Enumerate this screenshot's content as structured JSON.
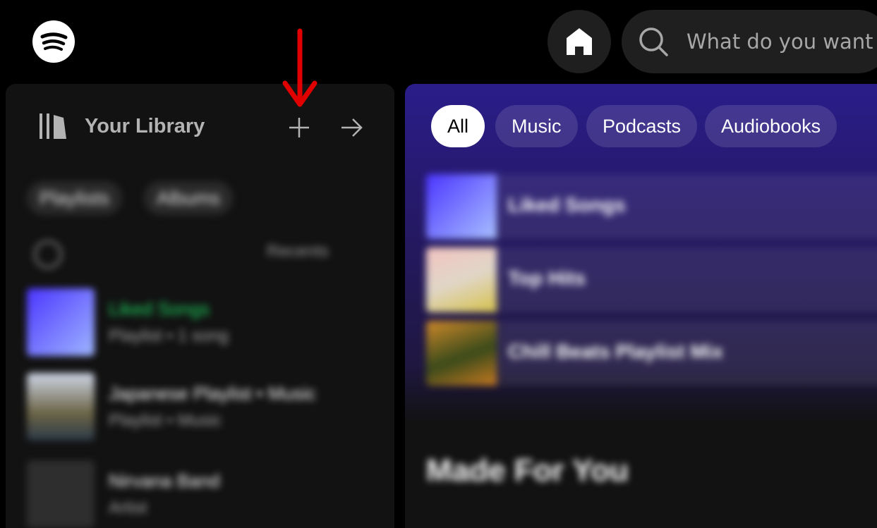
{
  "header": {
    "logo_icon": "spotify-logo-icon",
    "home_icon": "home-icon",
    "search_icon": "search-icon",
    "search_placeholder": "What do you want to play?"
  },
  "library": {
    "title": "Your Library",
    "library_icon": "library-icon",
    "create_icon": "plus-icon",
    "expand_icon": "arrow-right-icon",
    "annotation_arrow_color": "#e00000",
    "filters": [
      "Playlists",
      "Albums"
    ],
    "sort_label": "Recents",
    "items": [
      {
        "name": "Liked Songs",
        "subtitle": "Playlist • 1 song",
        "thumb": "#6b5cff"
      },
      {
        "name": "Japanese Playlist • Music",
        "subtitle": "Playlist • Music",
        "thumb": "#9aa3b5"
      },
      {
        "name": "Nirvana Band",
        "subtitle": "Artist",
        "thumb": "#2e2e2e"
      }
    ]
  },
  "main": {
    "tabs": [
      {
        "label": "All",
        "active": true
      },
      {
        "label": "Music",
        "active": false
      },
      {
        "label": "Podcasts",
        "active": false
      },
      {
        "label": "Audiobooks",
        "active": false
      }
    ],
    "cards": [
      {
        "name": "Liked Songs",
        "thumb": "#7a6bff"
      },
      {
        "name": "Top Hits",
        "thumb": "#e8b5b0"
      },
      {
        "name": "Chill Beats Playlist Mix",
        "thumb": "#c88a2a"
      }
    ],
    "section_title": "Made For You"
  },
  "colors": {
    "background": "#000000",
    "panel": "#121212",
    "accent_green": "#1ed760",
    "main_gradient_top": "#2a1d8a"
  }
}
